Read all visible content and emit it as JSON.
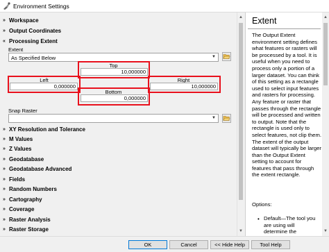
{
  "window": {
    "title": "Environment Settings"
  },
  "sections_top": [
    {
      "label": "Workspace"
    },
    {
      "label": "Output Coordinates"
    },
    {
      "label": "Processing Extent"
    }
  ],
  "extent": {
    "label": "Extent",
    "selected": "As Specified Below",
    "top_label": "Top",
    "top_value": "10,000000",
    "left_label": "Left",
    "left_value": "0,000000",
    "right_label": "Right",
    "right_value": "10,000000",
    "bottom_label": "Bottom",
    "bottom_value": "0,000000",
    "highlight_color": "#e8101c"
  },
  "snap_raster": {
    "label": "Snap Raster",
    "value": ""
  },
  "sections_bottom": [
    {
      "label": "XY Resolution and Tolerance"
    },
    {
      "label": "M Values"
    },
    {
      "label": "Z Values"
    },
    {
      "label": "Geodatabase"
    },
    {
      "label": "Geodatabase Advanced"
    },
    {
      "label": "Fields"
    },
    {
      "label": "Random Numbers"
    },
    {
      "label": "Cartography"
    },
    {
      "label": "Coverage"
    },
    {
      "label": "Raster Analysis"
    },
    {
      "label": "Raster Storage"
    }
  ],
  "help": {
    "title": "Extent",
    "body": "The Output Extent environment setting defines what features or rasters will be processed by a tool. It is useful when you need to process only a portion of a larger dataset. You can think of this setting as a rectangle used to select input features and rasters for processing. Any feature or raster that passes through the rectangle will be processed and written to output. Note that the rectangle is used only to select features, not clip them. The extent of the output dataset will typically be larger than the Output Extent setting to account for features that pass through the extent rectangle.",
    "options_label": "Options:",
    "bullet": "•",
    "default_text": "Default—The tool you are using will determine the"
  },
  "buttons": {
    "ok": "OK",
    "cancel": "Cancel",
    "hide_help": "<< Hide Help",
    "tool_help": "Tool Help"
  },
  "icons": {
    "app": "environment-settings-icon",
    "chevron": "double-chevron-down-icon",
    "folder": "open-folder-icon",
    "dropdown": "dropdown-arrow-icon"
  }
}
